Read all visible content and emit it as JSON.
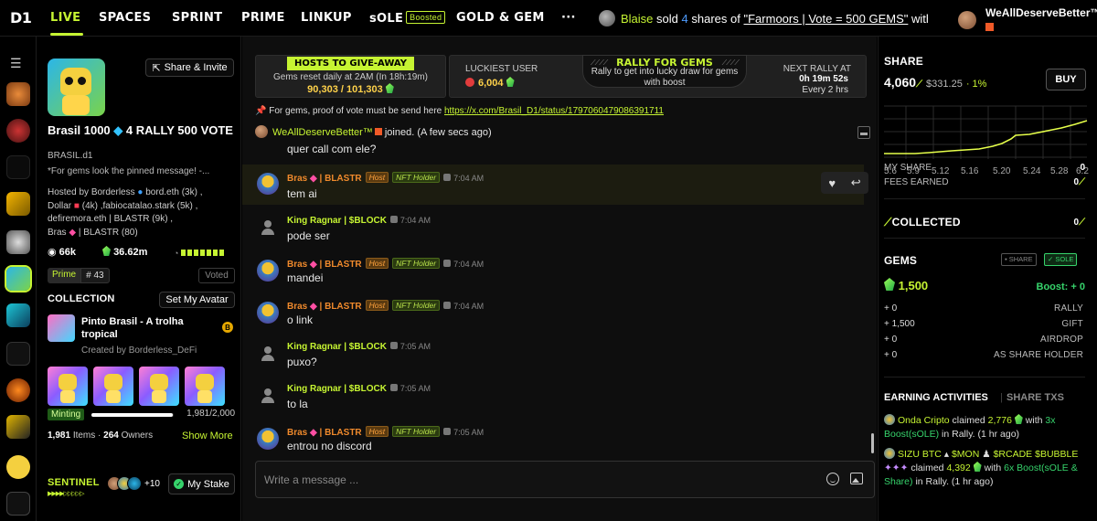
{
  "nav": {
    "logo": "D1",
    "items": [
      "LIVE",
      "SPACES",
      "SPRINT",
      "PRIME",
      "LINKUP",
      "sOLE",
      "GOLD & GEM",
      "···"
    ],
    "boosted_badge": "Boosted",
    "ticker": {
      "user": "Blaise",
      "pre": "sold",
      "shares": "4",
      "mid": "shares of",
      "link": "\"Farmoors | Vote = 500 GEMS\"",
      "post": "with..."
    },
    "current_user": "WeAllDeserveBetter™"
  },
  "channel": {
    "title_a": "Brasil 1000",
    "title_b": "4 RALLY 500 VOTE",
    "handle": "BRASIL.d1",
    "description": "*For gems look the pinned message! -...",
    "hosted_label": "Hosted by",
    "hosts_line1_a": "Borderless",
    "hosts_line1_b": "bord.eth (3k) ,",
    "hosts_line2_a": "Dollar",
    "hosts_line2_b": "(4k) ,fabiocatalao.stark (5k) ,",
    "hosts_line3": "defiremora.eth | BLASTR (9k) ,",
    "hosts_line4_a": "Bras",
    "hosts_line4_b": "| BLASTR (80)",
    "viewers": "66k",
    "gems": "36.62m",
    "prime_label": "Prime",
    "prime_rank": "# 43",
    "voted_label": "Voted",
    "share_invite_label": "Share & Invite"
  },
  "collection": {
    "heading": "COLLECTION",
    "set_avatar_label": "Set My Avatar",
    "nft_title": "Pinto Brasil - A trolha tropical",
    "nft_badge": "B",
    "creator": "Created by Borderless_DeFi",
    "minting_label": "Minting",
    "minted": 1981,
    "supply": 2000,
    "mint_count": "1,981/2,000",
    "items_count": "1,981",
    "items_label": "Items",
    "owners_count": "264",
    "owners_label": "Owners",
    "show_more_label": "Show More"
  },
  "sentinel": {
    "label": "SENTINEL",
    "more": "+10",
    "my_stake_label": "My Stake"
  },
  "banners": {
    "hosts_title": "HOSTS TO GIVE-AWAY",
    "hosts_sub": "Gems reset daily at 2AM (In 18h:19m)",
    "hosts_count": "90,303 / 101,303",
    "rally_title": "RALLY FOR GEMS",
    "rally_sub": "Rally to get into lucky draw for gems with boost",
    "lucky_label": "LUCKIEST USER",
    "lucky_value": "6,004",
    "next_label": "NEXT RALLY AT",
    "next_time": "0h 19m 52s",
    "next_every": "Every 2 hrs"
  },
  "pinned": {
    "text": "For gems, proof of vote must be send here",
    "link": "https://x.com/Brasil_D1/status/1797060479086391711"
  },
  "join": {
    "user": "WeAllDeserveBetter™",
    "text": "joined. (A few secs ago)"
  },
  "messages": [
    {
      "id": "m0",
      "text": "quer call com ele?"
    },
    {
      "id": "m1",
      "name": "Bras",
      "suffix": "| BLASTR",
      "host": "Host",
      "nft": "NFT Holder",
      "time": "7:04 AM",
      "text": "tem ai"
    },
    {
      "id": "m2",
      "name": "King Ragnar | $BLOCK",
      "time": "7:04 AM",
      "text": "pode ser"
    },
    {
      "id": "m3",
      "name": "Bras",
      "suffix": "| BLASTR",
      "host": "Host",
      "nft": "NFT Holder",
      "time": "7:04 AM",
      "text": "mandei"
    },
    {
      "id": "m4",
      "name": "Bras",
      "suffix": "| BLASTR",
      "host": "Host",
      "nft": "NFT Holder",
      "time": "7:04 AM",
      "text": "o link"
    },
    {
      "id": "m5",
      "name": "King Ragnar | $BLOCK",
      "time": "7:05 AM",
      "text": "puxo?"
    },
    {
      "id": "m6",
      "name": "King Ragnar | $BLOCK",
      "time": "7:05 AM",
      "text": "to la"
    },
    {
      "id": "m7",
      "name": "Bras",
      "suffix": "| BLASTR",
      "host": "Host",
      "nft": "NFT Holder",
      "time": "7:05 AM",
      "text": "entrou no discord"
    }
  ],
  "composer": {
    "placeholder": "Write a message ..."
  },
  "share": {
    "heading": "SHARE",
    "price": "4,060",
    "usd": "$331.25",
    "change": "1%",
    "buy_label": "BUY",
    "x_ticks": [
      "5.6",
      "5.9",
      "5.12",
      "5.16",
      "5.20",
      "5.24",
      "5.28",
      "6.2"
    ],
    "my_share_label": "MY SHARE",
    "my_share_value": "0",
    "fees_label": "FEES EARNED",
    "fees_value": "0"
  },
  "collected": {
    "label": "COLLECTED",
    "value": "0"
  },
  "gems_panel": {
    "heading": "GEMS",
    "total": "1,500",
    "boost": "Boost: + 0",
    "toggle_share": "SHARE",
    "toggle_sole": "SOLE",
    "rows": [
      {
        "value": "+ 0",
        "label": "RALLY"
      },
      {
        "value": "+ 1,500",
        "label": "GIFT"
      },
      {
        "value": "+ 0",
        "label": "AIRDROP"
      },
      {
        "value": "+ 0",
        "label": "AS SHARE HOLDER"
      }
    ]
  },
  "activities": {
    "tab_earning": "EARNING ACTIVITIES",
    "tab_share_txs": "SHARE TXS",
    "a1_user": "Onda Cripto",
    "a1_pre": "claimed",
    "a1_amount": "2,776",
    "a1_with": "with",
    "a1_boost": "3x Boost(sOLE)",
    "a1_post": "in Rally. (1 hr ago)",
    "a2_user": "SIZU BTC",
    "a2_t1": "$MON",
    "a2_t2": "$RCADE",
    "a2_t3": "$BUBBLE",
    "a2_pre": "claimed",
    "a2_amount": "4,392",
    "a2_with": "with",
    "a2_boost": "6x Boost(sOLE & Share)",
    "a2_post": "in Rally. (1 hr ago)"
  },
  "colors": {
    "accent": "#c6f432",
    "green": "#36d36b",
    "host": "#f08a2c"
  }
}
